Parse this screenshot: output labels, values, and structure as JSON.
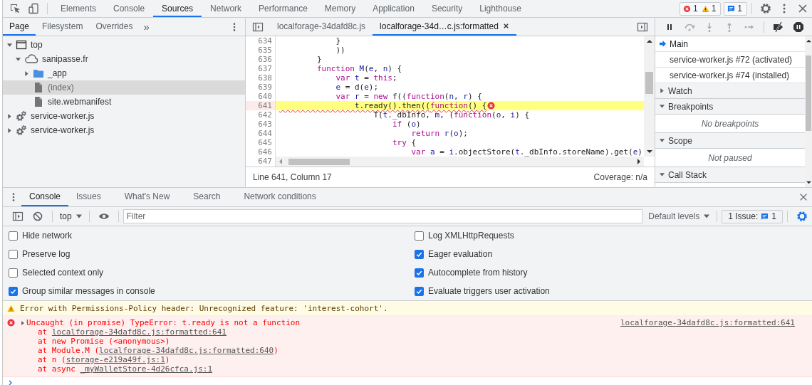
{
  "toolbar": {
    "tabs": [
      {
        "label": "Elements",
        "selected": false
      },
      {
        "label": "Console",
        "selected": false
      },
      {
        "label": "Sources",
        "selected": true
      },
      {
        "label": "Network",
        "selected": false
      },
      {
        "label": "Performance",
        "selected": false
      },
      {
        "label": "Memory",
        "selected": false
      },
      {
        "label": "Application",
        "selected": false
      },
      {
        "label": "Security",
        "selected": false
      },
      {
        "label": "Lighthouse",
        "selected": false
      }
    ],
    "counts": {
      "errors": "1",
      "warnings": "1",
      "issues": "1"
    }
  },
  "navigator": {
    "tabs": [
      {
        "label": "Page",
        "selected": true
      },
      {
        "label": "Filesystem",
        "selected": false
      },
      {
        "label": "Overrides",
        "selected": false
      }
    ],
    "more": "»",
    "tree": [
      {
        "label": "top",
        "kind": "frame",
        "expanded": true,
        "selected": false,
        "children": [
          {
            "label": "sanipasse.fr",
            "kind": "cloud",
            "expanded": true,
            "selected": false,
            "children": [
              {
                "label": "_app",
                "kind": "folder",
                "expanded": false,
                "selected": false
              },
              {
                "label": "(index)",
                "kind": "file",
                "selected": true
              },
              {
                "label": "site.webmanifest",
                "kind": "file",
                "selected": false
              }
            ]
          }
        ]
      },
      {
        "label": "service-worker.js",
        "kind": "worker",
        "expanded": false,
        "selected": false
      },
      {
        "label": "service-worker.js",
        "kind": "worker",
        "expanded": false,
        "selected": false
      }
    ]
  },
  "editor": {
    "tabs": [
      {
        "label": "localforage-34dafd8c.js",
        "selected": false,
        "closable": false
      },
      {
        "label": "localforage-34d…c.js:formatted",
        "selected": true,
        "closable": true
      }
    ],
    "lines": [
      {
        "number": "634",
        "error": false,
        "segments": [
          {
            "text": "            }",
            "kind": "plain"
          }
        ]
      },
      {
        "number": "635",
        "error": false,
        "segments": [
          {
            "text": "            ))",
            "kind": "plain"
          }
        ]
      },
      {
        "number": "636",
        "error": false,
        "segments": [
          {
            "text": "        }",
            "kind": "plain"
          }
        ]
      },
      {
        "number": "637",
        "error": false,
        "segments": [
          {
            "text": "        function",
            "kind": "keyword"
          },
          {
            "text": " M",
            "kind": "variable"
          },
          {
            "text": "(",
            "kind": "plain"
          },
          {
            "text": "e",
            "kind": "variable"
          },
          {
            "text": ", ",
            "kind": "plain"
          },
          {
            "text": "n",
            "kind": "variable"
          },
          {
            "text": ") {",
            "kind": "plain"
          }
        ]
      },
      {
        "number": "638",
        "error": false,
        "segments": [
          {
            "text": "            var",
            "kind": "keyword"
          },
          {
            "text": " t",
            "kind": "variable"
          },
          {
            "text": " = ",
            "kind": "plain"
          },
          {
            "text": "this",
            "kind": "keyword"
          },
          {
            "text": ";",
            "kind": "plain"
          }
        ]
      },
      {
        "number": "639",
        "error": false,
        "segments": [
          {
            "text": "            e",
            "kind": "variable"
          },
          {
            "text": " = d(",
            "kind": "plain"
          },
          {
            "text": "e",
            "kind": "variable"
          },
          {
            "text": ");",
            "kind": "plain"
          }
        ]
      },
      {
        "number": "640",
        "error": false,
        "segments": [
          {
            "text": "            var",
            "kind": "keyword"
          },
          {
            "text": " r",
            "kind": "variable"
          },
          {
            "text": " = ",
            "kind": "plain"
          },
          {
            "text": "new",
            "kind": "keyword"
          },
          {
            "text": " f((",
            "kind": "plain"
          },
          {
            "text": "function",
            "kind": "keyword"
          },
          {
            "text": "(",
            "kind": "plain"
          },
          {
            "text": "n",
            "kind": "variable"
          },
          {
            "text": ", ",
            "kind": "plain"
          },
          {
            "text": "r",
            "kind": "variable"
          },
          {
            "text": ") {",
            "kind": "plain"
          }
        ]
      },
      {
        "number": "641",
        "error": true,
        "segments": [
          {
            "text": "                t.ready().then((",
            "kind": "plain"
          },
          {
            "text": "function",
            "kind": "keyword"
          },
          {
            "text": "() {",
            "kind": "plain"
          }
        ]
      },
      {
        "number": "642",
        "error": false,
        "segments": [
          {
            "text": "                    T(",
            "kind": "plain"
          },
          {
            "text": "t",
            "kind": "variable"
          },
          {
            "text": "._dbInfo, ",
            "kind": "plain"
          },
          {
            "text": "m",
            "kind": "variable"
          },
          {
            "text": ", (",
            "kind": "plain"
          },
          {
            "text": "function",
            "kind": "keyword"
          },
          {
            "text": "(",
            "kind": "plain"
          },
          {
            "text": "o",
            "kind": "variable"
          },
          {
            "text": ", ",
            "kind": "plain"
          },
          {
            "text": "i",
            "kind": "variable"
          },
          {
            "text": ") {",
            "kind": "plain"
          }
        ]
      },
      {
        "number": "643",
        "error": false,
        "segments": [
          {
            "text": "                        if",
            "kind": "keyword"
          },
          {
            "text": " (",
            "kind": "plain"
          },
          {
            "text": "o",
            "kind": "variable"
          },
          {
            "text": ")",
            "kind": "plain"
          }
        ]
      },
      {
        "number": "644",
        "error": false,
        "segments": [
          {
            "text": "                            return",
            "kind": "keyword"
          },
          {
            "text": " r",
            "kind": "variable"
          },
          {
            "text": "(",
            "kind": "plain"
          },
          {
            "text": "o",
            "kind": "variable"
          },
          {
            "text": ");",
            "kind": "plain"
          }
        ]
      },
      {
        "number": "645",
        "error": false,
        "segments": [
          {
            "text": "                        try",
            "kind": "keyword"
          },
          {
            "text": " {",
            "kind": "plain"
          }
        ]
      },
      {
        "number": "646",
        "error": false,
        "segments": [
          {
            "text": "                            var",
            "kind": "keyword"
          },
          {
            "text": " a",
            "kind": "variable"
          },
          {
            "text": " = ",
            "kind": "plain"
          },
          {
            "text": "i",
            "kind": "variable"
          },
          {
            "text": ".objectStore(",
            "kind": "plain"
          },
          {
            "text": "t",
            "kind": "variable"
          },
          {
            "text": "._dbInfo.storeName).get(",
            "kind": "plain"
          },
          {
            "text": "e",
            "kind": "variable"
          },
          {
            "text": ")",
            "kind": "plain"
          }
        ]
      },
      {
        "number": "647",
        "error": false
      }
    ],
    "status": "Line 641, Column 17",
    "coverage": "Coverage: n/a"
  },
  "debugger": {
    "threads": [
      {
        "label": "Main",
        "selected": true
      },
      {
        "label": "service-worker.js #72 (activated)",
        "selected": false
      },
      {
        "label": "service-worker.js #74 (installed)",
        "selected": false
      }
    ],
    "sections": [
      {
        "title": "Watch",
        "expanded": false
      },
      {
        "title": "Breakpoints",
        "expanded": true,
        "empty": "No breakpoints"
      },
      {
        "title": "Scope",
        "expanded": true,
        "empty": "Not paused"
      },
      {
        "title": "Call Stack",
        "expanded": true
      }
    ]
  },
  "drawer": {
    "tabs": [
      {
        "label": "Console",
        "selected": true
      },
      {
        "label": "Issues",
        "selected": false
      },
      {
        "label": "What's New",
        "selected": false
      },
      {
        "label": "Search",
        "selected": false
      },
      {
        "label": "Network conditions",
        "selected": false
      }
    ],
    "context": "top",
    "filter": {
      "placeholder": "Filter"
    },
    "levels": "Default levels",
    "issues": {
      "label": "1 Issue:",
      "count": "1"
    },
    "settings": [
      {
        "label": "Hide network",
        "checked": false
      },
      {
        "label": "Preserve log",
        "checked": false
      },
      {
        "label": "Selected context only",
        "checked": false
      },
      {
        "label": "Group similar messages in console",
        "checked": true
      },
      {
        "label": "Log XMLHttpRequests",
        "checked": false
      },
      {
        "label": "Eager evaluation",
        "checked": true
      },
      {
        "label": "Autocomplete from history",
        "checked": true
      },
      {
        "label": "Evaluate triggers user activation",
        "checked": true
      }
    ],
    "messages": [
      {
        "kind": "warning",
        "text": "Error with Permissions-Policy header: Unrecognized feature: 'interest-cohort'."
      },
      {
        "kind": "error",
        "text": "Uncaught (in promise) TypeError: t.ready is not a function",
        "source": "localforage-34dafd8c.js:formatted:641",
        "stack": [
          {
            "prefix": "at ",
            "link": "localforage-34dafd8c.js:formatted:641"
          },
          {
            "prefix": "at new Promise (<anonymous>)"
          },
          {
            "prefix": "at Module.M (",
            "link": "localforage-34dafd8c.js:formatted:640",
            "suffix": ")"
          },
          {
            "prefix": "at n (",
            "link": "storage-e219a49f.js:1",
            "suffix": ")"
          },
          {
            "prefix": "at async ",
            "link": "_myWalletStore-4d26cfca.js:1"
          }
        ]
      }
    ]
  }
}
